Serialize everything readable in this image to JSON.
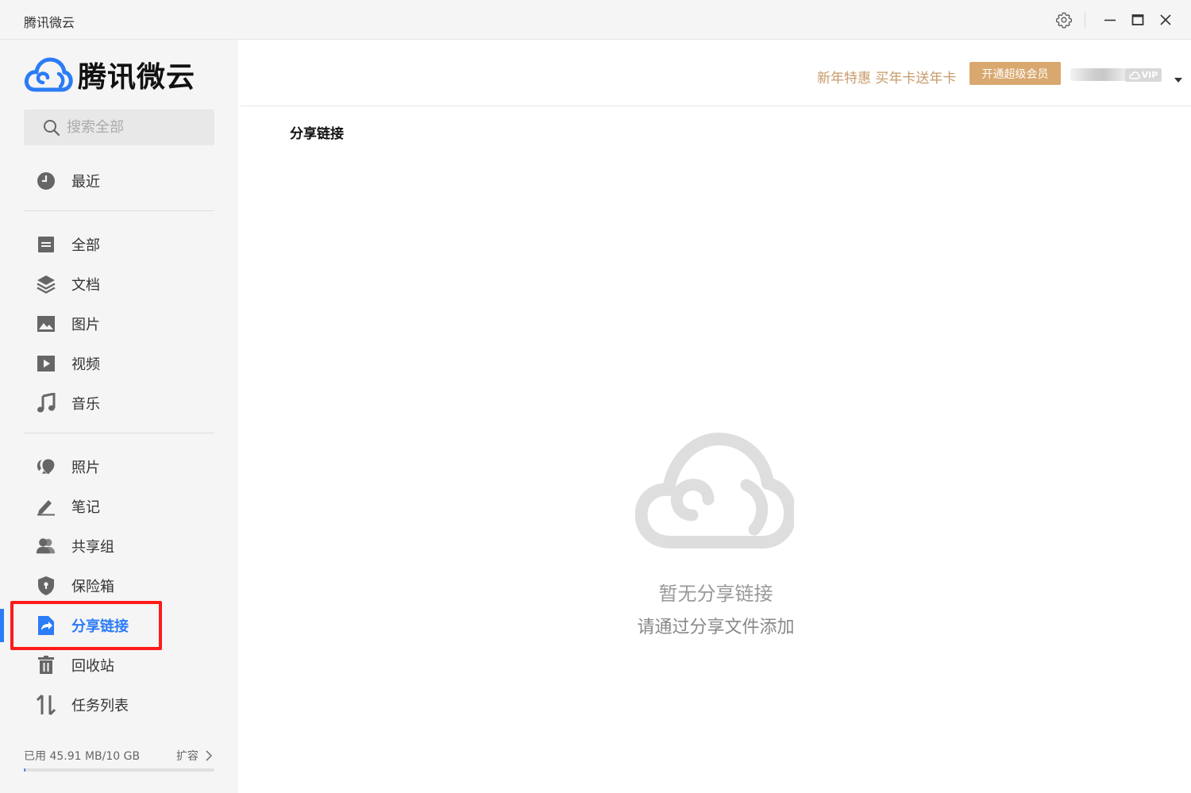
{
  "window": {
    "title": "腾讯微云",
    "controls": [
      "gear-icon",
      "minimize-icon",
      "maximize-icon",
      "close-icon"
    ]
  },
  "sidebar": {
    "logo_text": "腾讯微云",
    "search_placeholder": "搜索全部",
    "items": [
      {
        "label": "最近",
        "icon": "clock-icon"
      },
      {
        "label": "全部",
        "icon": "document-icon"
      },
      {
        "label": "文档",
        "icon": "layers-icon"
      },
      {
        "label": "图片",
        "icon": "image-icon"
      },
      {
        "label": "视频",
        "icon": "video-icon"
      },
      {
        "label": "音乐",
        "icon": "music-icon"
      },
      {
        "label": "照片",
        "icon": "photos-icon"
      },
      {
        "label": "笔记",
        "icon": "pen-icon"
      },
      {
        "label": "共享组",
        "icon": "users-icon"
      },
      {
        "label": "保险箱",
        "icon": "shield-icon"
      },
      {
        "label": "分享链接",
        "icon": "share-link-icon",
        "active": true
      },
      {
        "label": "回收站",
        "icon": "trash-icon"
      },
      {
        "label": "任务列表",
        "icon": "transfer-icon"
      }
    ],
    "storage": {
      "used_text": "已用 45.91 MB/10 GB",
      "expand_label": "扩容",
      "used_fraction": 0.0045
    }
  },
  "header": {
    "promo_text": "新年特惠 买年卡送年卡",
    "vip_button_label": "开通超级会员",
    "vip_badge": "VIP"
  },
  "main": {
    "title": "分享链接",
    "empty_title": "暂无分享链接",
    "empty_subtitle": "请通过分享文件添加"
  },
  "colors": {
    "accent": "#2b7cf6",
    "promo": "#c79a6a",
    "vip_button": "#d9a86f",
    "highlight": "#ff1a1a"
  }
}
